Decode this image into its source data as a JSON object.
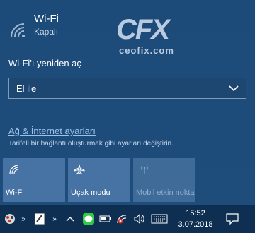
{
  "wifi": {
    "title": "Wi-Fi",
    "state": "Kapalı",
    "icon": "wifi-icon"
  },
  "logo": {
    "big": "CFX",
    "small": "ceofix.com"
  },
  "reopen": {
    "label": "Wi-Fi'ı yeniden aç",
    "selected": "El ile"
  },
  "network": {
    "link": "Ağ & İnternet ayarları",
    "description": "Tarifeli bir bağlantı oluşturmak gibi ayarları değiştirin."
  },
  "tiles": [
    {
      "label": "Wi-Fi",
      "icon": "wifi-icon",
      "enabled": true
    },
    {
      "label": "Uçak modu",
      "icon": "airplane-icon",
      "enabled": true
    },
    {
      "label": "Mobil etkin nokta",
      "icon": "hotspot-icon",
      "enabled": false
    }
  ],
  "taskbar": {
    "time": "15:52",
    "date": "3.07.2018",
    "icons": [
      "app-icon",
      "chevron-icon",
      "app-icon",
      "chevron-icon",
      "show-hidden-icon",
      "line-icon",
      "battery-icon",
      "network-off-icon",
      "volume-icon",
      "keyboard-icon",
      "action-center-icon"
    ]
  },
  "colors": {
    "panel": "#1f4d7b",
    "tile": "#4673a3",
    "taskbar": "#0f2f52",
    "link": "#9bc2ea"
  }
}
